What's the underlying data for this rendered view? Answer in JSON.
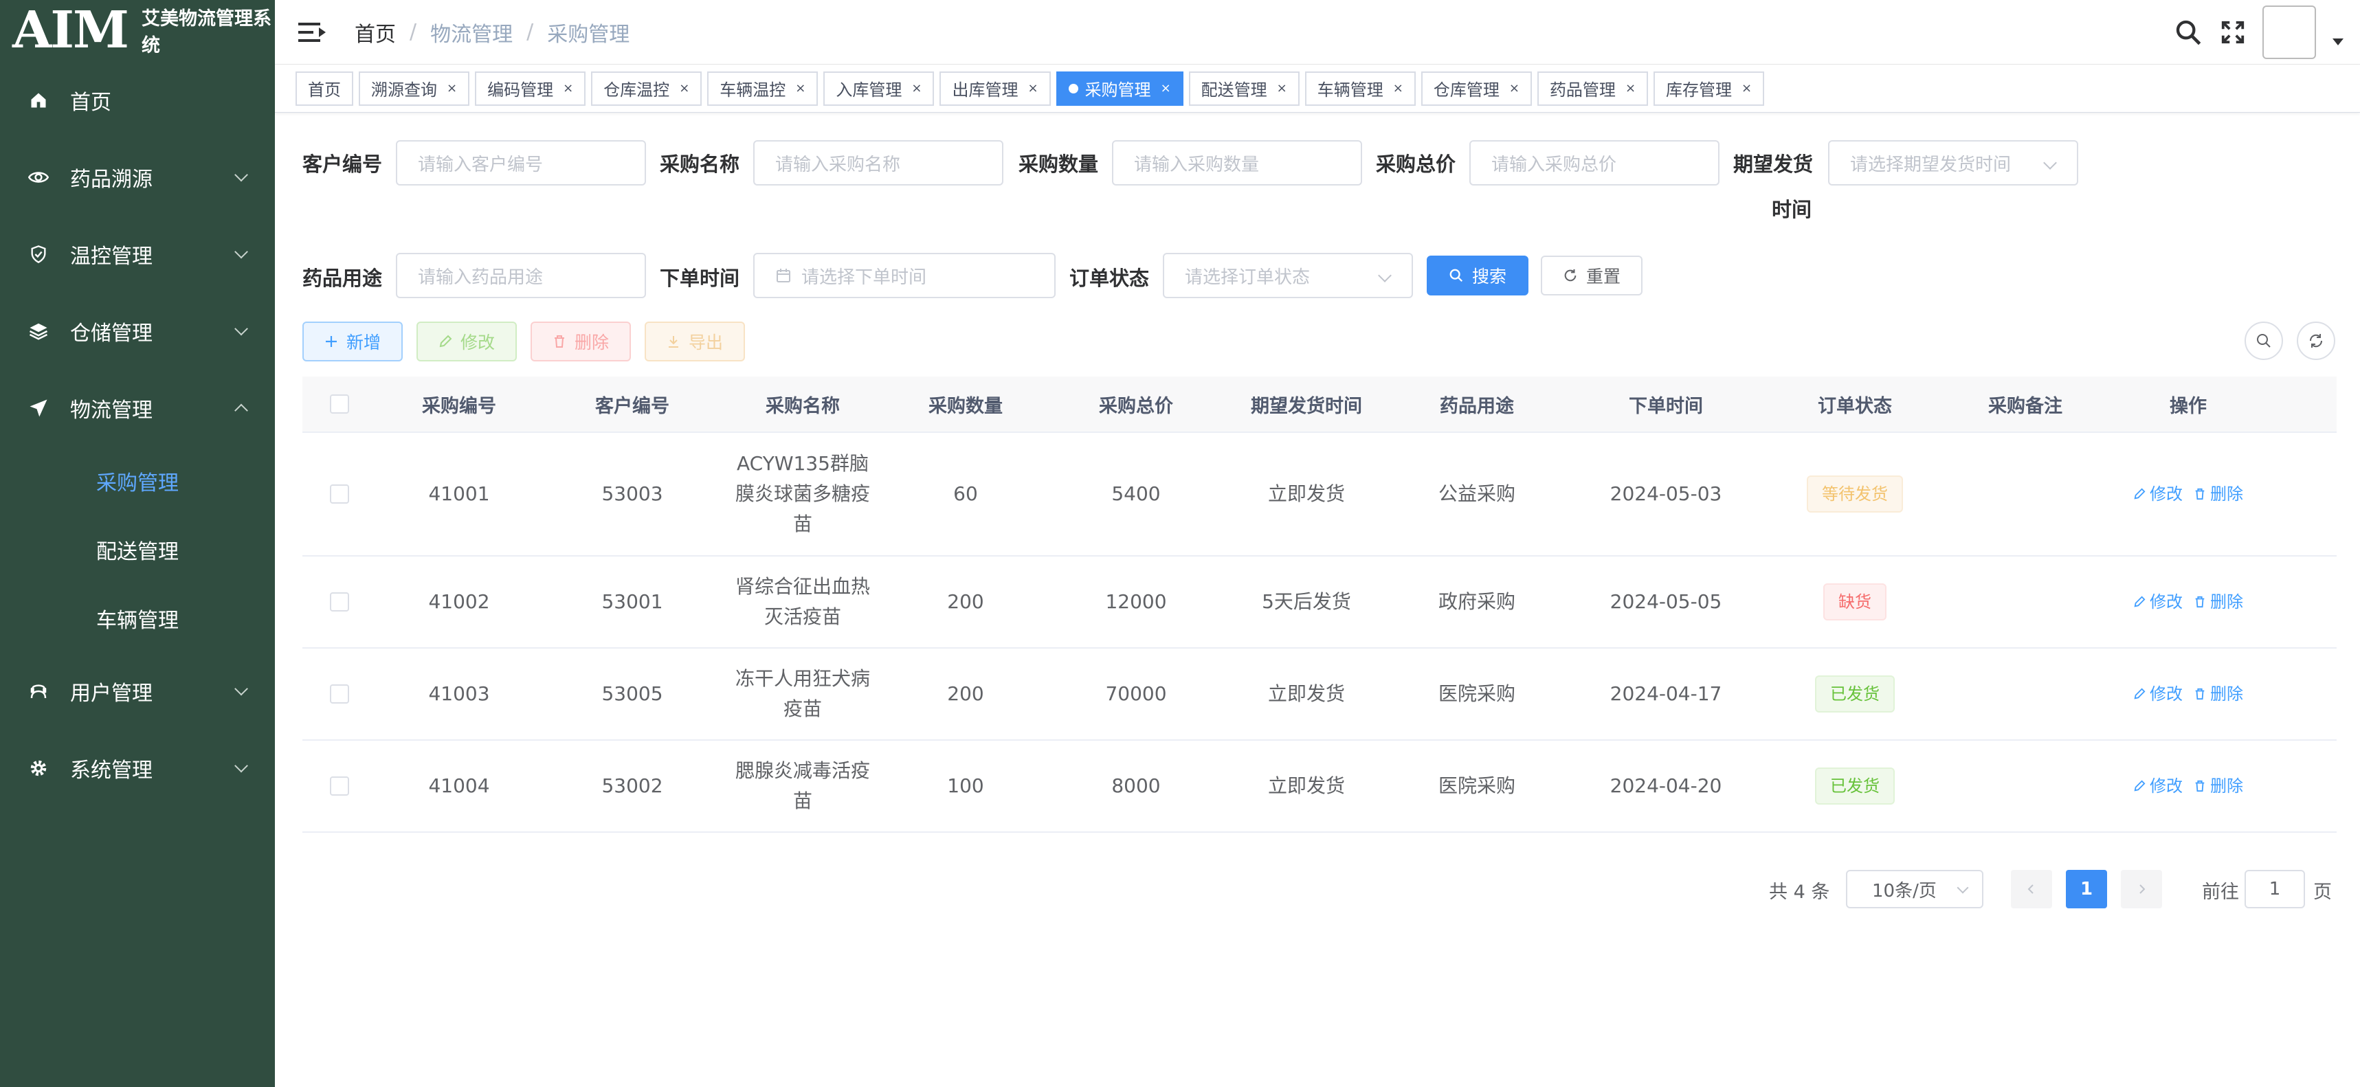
{
  "app": {
    "logo": "AIM",
    "title": "艾美物流管理系统"
  },
  "sidebar": {
    "items": [
      {
        "label": "首页",
        "icon": "home-icon"
      },
      {
        "label": "药品溯源",
        "icon": "eye-icon"
      },
      {
        "label": "温控管理",
        "icon": "shield-icon"
      },
      {
        "label": "仓储管理",
        "icon": "layers-icon"
      },
      {
        "label": "物流管理",
        "icon": "send-icon"
      },
      {
        "label": "用户管理",
        "icon": "user-icon"
      },
      {
        "label": "系统管理",
        "icon": "gear-icon"
      }
    ],
    "sub_items": [
      {
        "label": "采购管理",
        "active": true
      },
      {
        "label": "配送管理",
        "active": false
      },
      {
        "label": "车辆管理",
        "active": false
      }
    ]
  },
  "breadcrumb": {
    "home": "首页",
    "separator": "/",
    "parent": "物流管理",
    "current": "采购管理"
  },
  "tabs": [
    {
      "label": "首页",
      "closable": false,
      "active": false
    },
    {
      "label": "溯源查询",
      "closable": true,
      "active": false
    },
    {
      "label": "编码管理",
      "closable": true,
      "active": false
    },
    {
      "label": "仓库温控",
      "closable": true,
      "active": false
    },
    {
      "label": "车辆温控",
      "closable": true,
      "active": false
    },
    {
      "label": "入库管理",
      "closable": true,
      "active": false
    },
    {
      "label": "出库管理",
      "closable": true,
      "active": false
    },
    {
      "label": "采购管理",
      "closable": true,
      "active": true
    },
    {
      "label": "配送管理",
      "closable": true,
      "active": false
    },
    {
      "label": "车辆管理",
      "closable": true,
      "active": false
    },
    {
      "label": "仓库管理",
      "closable": true,
      "active": false
    },
    {
      "label": "药品管理",
      "closable": true,
      "active": false
    },
    {
      "label": "库存管理",
      "closable": true,
      "active": false
    }
  ],
  "tab_close": "×",
  "search_form": {
    "customer_id": {
      "label": "客户编号",
      "placeholder": "请输入客户编号"
    },
    "purchase_name": {
      "label": "采购名称",
      "placeholder": "请输入采购名称"
    },
    "purchase_qty": {
      "label": "采购数量",
      "placeholder": "请输入采购数量"
    },
    "purchase_total": {
      "label": "采购总价",
      "placeholder": "请输入采购总价"
    },
    "expected_ship": {
      "label_line1": "期望发货",
      "label_line2": "时间",
      "placeholder": "请选择期望发货时间"
    },
    "drug_use": {
      "label": "药品用途",
      "placeholder": "请输入药品用途"
    },
    "order_time": {
      "label": "下单时间",
      "placeholder": "请选择下单时间"
    },
    "order_status": {
      "label": "订单状态",
      "placeholder": "请选择订单状态"
    },
    "search_label": "搜索",
    "reset_label": "重置"
  },
  "toolbar": {
    "add_label": "新增",
    "edit_label": "修改",
    "delete_label": "删除",
    "export_label": "导出"
  },
  "table": {
    "columns": [
      "采购编号",
      "客户编号",
      "采购名称",
      "采购数量",
      "采购总价",
      "期望发货时间",
      "药品用途",
      "下单时间",
      "订单状态",
      "采购备注",
      "操作"
    ],
    "rows": [
      {
        "id": "41001",
        "customer": "53003",
        "name": "ACYW135群脑膜炎球菌多糖疫苗",
        "qty": "60",
        "total": "5400",
        "ship": "立即发货",
        "use": "公益采购",
        "date": "2024-05-03",
        "status": "等待发货",
        "status_type": "warning",
        "note": ""
      },
      {
        "id": "41002",
        "customer": "53001",
        "name": "肾综合征出血热灭活疫苗",
        "qty": "200",
        "total": "12000",
        "ship": "5天后发货",
        "use": "政府采购",
        "date": "2024-05-05",
        "status": "缺货",
        "status_type": "danger",
        "note": ""
      },
      {
        "id": "41003",
        "customer": "53005",
        "name": "冻干人用狂犬病疫苗",
        "qty": "200",
        "total": "70000",
        "ship": "立即发货",
        "use": "医院采购",
        "date": "2024-04-17",
        "status": "已发货",
        "status_type": "success",
        "note": ""
      },
      {
        "id": "41004",
        "customer": "53002",
        "name": "腮腺炎减毒活疫苗",
        "qty": "100",
        "total": "8000",
        "ship": "立即发货",
        "use": "医院采购",
        "date": "2024-04-20",
        "status": "已发货",
        "status_type": "success",
        "note": ""
      }
    ],
    "row_edit": "修改",
    "row_delete": "删除"
  },
  "pagination": {
    "total": "共 4 条",
    "page_size": "10条/页",
    "current": "1",
    "goto_prefix": "前往",
    "goto_value": "1",
    "goto_suffix": "页"
  },
  "colors": {
    "sidebar_bg": "#304d40",
    "primary": "#3d8ef5",
    "active_sub": "#5fa8ff"
  }
}
